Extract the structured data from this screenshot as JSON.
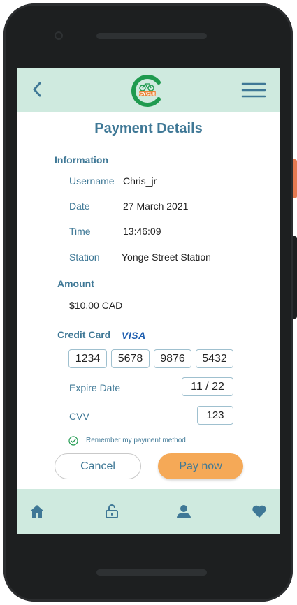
{
  "header": {
    "back_icon": "chevron-left-icon",
    "logo_text": "CYCLE",
    "menu_icon": "hamburger-menu-icon"
  },
  "page": {
    "title": "Payment Details"
  },
  "information": {
    "section_label": "Information",
    "rows": [
      {
        "label": "Username",
        "value": "Chris_jr"
      },
      {
        "label": "Date",
        "value": "27 March 2021"
      },
      {
        "label": "Time",
        "value": "13:46:09"
      },
      {
        "label": "Station",
        "value": "Yonge Street Station"
      }
    ]
  },
  "amount": {
    "section_label": "Amount",
    "value": "$10.00 CAD"
  },
  "credit_card": {
    "section_label": "Credit Card",
    "brand": "VISA",
    "number_groups": [
      "1234",
      "5678",
      "9876",
      "5432"
    ],
    "expire_label": "Expire Date",
    "expire_value": "11 / 22",
    "cvv_label": "CVV",
    "cvv_value": "123",
    "remember_label": "Remember my payment method",
    "remember_checked": true
  },
  "actions": {
    "cancel_label": "Cancel",
    "pay_label": "Pay now"
  },
  "bottom_nav": {
    "items": [
      "home-icon",
      "unlock-icon",
      "profile-icon",
      "favorites-heart-icon"
    ]
  },
  "colors": {
    "accent": "#3f7896",
    "header_bg": "#cfeadf",
    "pay_button": "#f5a957",
    "logo_green": "#1f9a4f",
    "logo_orange": "#e8853a"
  }
}
